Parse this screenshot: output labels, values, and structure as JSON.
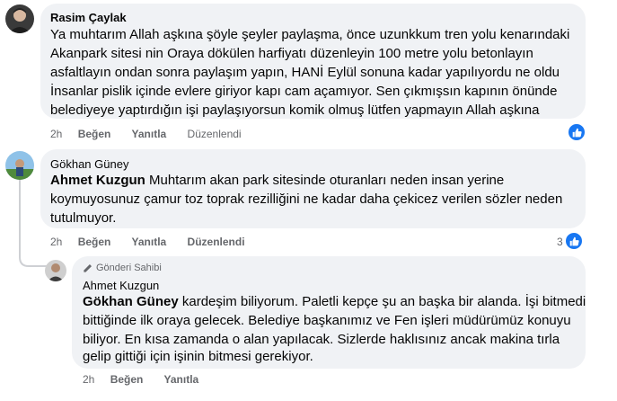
{
  "comments": [
    {
      "author": "Rasim Çaylak",
      "lines": [
        "Ya muhtarım Allah aşkına şöyle şeyler paylaşma, önce uzunkkum tren yolu kenarındaki",
        "Akanpark sitesi nin Oraya dökülen harfiyatı düzenleyin 100 metre yolu betonlayın",
        "asfaltlayın ondan sonra paylaşım yapın, HANİ Eylül sonuna kadar yapılıyordu ne oldu",
        "İnsanlar pislik içinde evlere giriyor kapı cam açamıyor. Sen çıkmışsın kapının önünde",
        "belediyeye yaptırdığın işi paylaşıyorsun komik olmuş lütfen yapmayın Allah aşkına"
      ],
      "time": "2h",
      "like": "Beğen",
      "reply": "Yanıtla",
      "edited": "Düzenlendi"
    },
    {
      "author": "Gökhan Güney",
      "mention": "Ahmet Kuzgun",
      "lines": [
        " Muhtarım akan park sitesinde oturanları neden insan yerine",
        "koymuyosunuz çamur toz toprak rezilliğini ne kadar daha çekicez verilen sözler neden",
        "tutulmuyor."
      ],
      "time": "2h",
      "like": "Beğen",
      "reply": "Yanıtla",
      "edited": "Düzenlendi",
      "reaction_count": "3"
    },
    {
      "badge": "Gönderi Sahibi",
      "author": "Ahmet Kuzgun",
      "mention": "Gökhan Güney",
      "lines": [
        " kardeşim biliyorum. Paletli kepçe şu an başka bir alanda. İşi bitmedi",
        "bittiğinde ilk oraya gelecek. Belediye başkanımız ve Fen işleri müdürümüz konuyu",
        "biliyor. En kısa zamanda o alan yapılacak. Sizlerde haklısınız ancak makina tırla",
        "gelip gittiği için işinin bitmesi gerekiyor."
      ],
      "time": "2h",
      "like": "Beğen",
      "reply": "Yanıtla"
    }
  ],
  "colors": {
    "bubble": "#f0f2f5",
    "meta": "#65676b",
    "like_blue": "#1877f2"
  }
}
